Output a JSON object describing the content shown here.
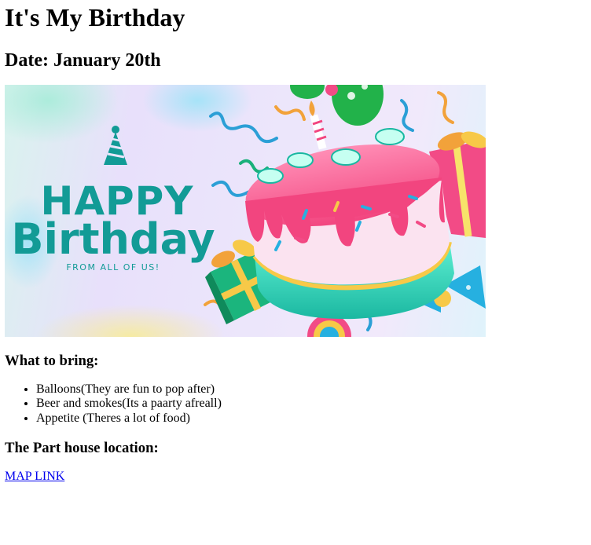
{
  "page": {
    "title": "It's My Birthday",
    "date": "Date: January 20th"
  },
  "banner": {
    "line1": "HAPPY",
    "line2": "Birthday",
    "line3": "FROM ALL OF US!"
  },
  "bring": {
    "heading": "What to bring:",
    "items": [
      "Balloons(They are fun to pop after)",
      "Beer and smokes(Its a paarty afreall)",
      "Appetite (Theres a lot of food)"
    ]
  },
  "location": {
    "heading": "The Part house location:",
    "link_text": "MAP LINK"
  },
  "colors": {
    "teal": "#129b96",
    "cake_pink": "#f2457f",
    "link": "#0000ee"
  }
}
